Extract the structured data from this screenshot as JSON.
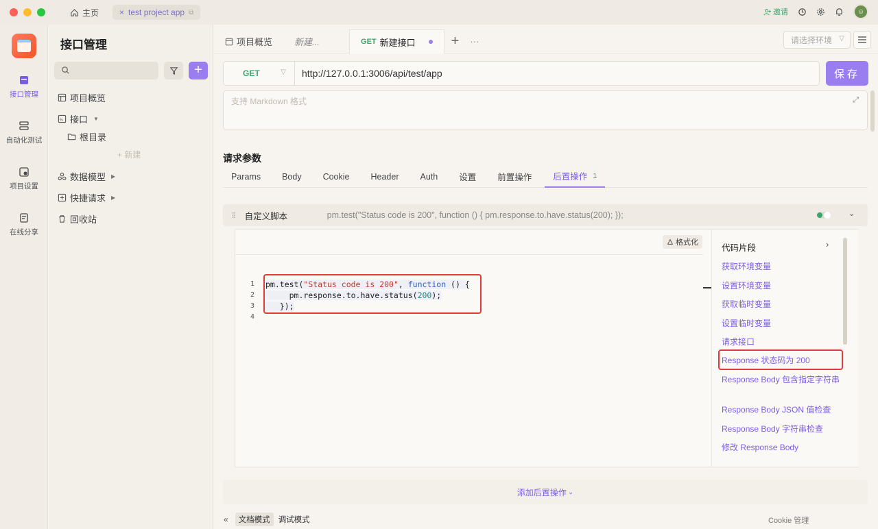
{
  "titlebar": {
    "home": "主页",
    "tab": "test project app",
    "invite": "邀请"
  },
  "rail": {
    "items": [
      {
        "label": "接口管理"
      },
      {
        "label": "自动化测试"
      },
      {
        "label": "项目设置"
      },
      {
        "label": "在线分享"
      }
    ]
  },
  "sidebar": {
    "title": "接口管理",
    "items": [
      {
        "label": "项目概览"
      },
      {
        "label": "接口"
      },
      {
        "label": "根目录"
      },
      {
        "label": "数据模型"
      },
      {
        "label": "快捷请求"
      },
      {
        "label": "回收站"
      }
    ],
    "new_label": "新建"
  },
  "tabs": {
    "overview": "项目概览",
    "new": "新建...",
    "active_method": "GET",
    "active_label": "新建接口",
    "env_placeholder": "请选择环境"
  },
  "request": {
    "method": "GET",
    "url": "http://127.0.0.1:3006/api/test/app",
    "save": "保存",
    "markdown_placeholder": "支持 Markdown 格式"
  },
  "params": {
    "title": "请求参数",
    "tabs": [
      "Params",
      "Body",
      "Cookie",
      "Header",
      "Auth",
      "设置",
      "前置操作",
      "后置操作"
    ],
    "active_badge": "1"
  },
  "script": {
    "name": "自定义脚本",
    "preview": "pm.test(\"Status code is 200\", function () { pm.response.to.have.status(200); });",
    "format": "格式化",
    "lines": [
      "1",
      "2",
      "3",
      "4"
    ],
    "code": {
      "l1a": "pm.test(",
      "l1b": "\"Status code is 200\"",
      "l1c": ", ",
      "l1d": "function",
      "l1e": " () {",
      "l2a": "     pm.response.to.have.status(",
      "l2b": "200",
      "l2c": ");",
      "l3": "   });"
    }
  },
  "snippets": {
    "title": "代码片段",
    "items": [
      "获取环境变量",
      "设置环境变量",
      "获取临时变量",
      "设置临时变量",
      "请求接口",
      "Response 状态码为 200",
      "Response Body 包含指定字符串",
      "Response Body JSON 值检查",
      "Response Body 字符串检查",
      "修改 Response Body"
    ]
  },
  "add_post": "添加后置操作",
  "status": {
    "doc_mode": "文档模式",
    "debug_mode": "调试模式",
    "cookie": "Cookie 管理"
  },
  "colors": {
    "accent": "#9a7ef0",
    "method_green": "#3aa56d",
    "highlight_red": "#e03a3a"
  }
}
